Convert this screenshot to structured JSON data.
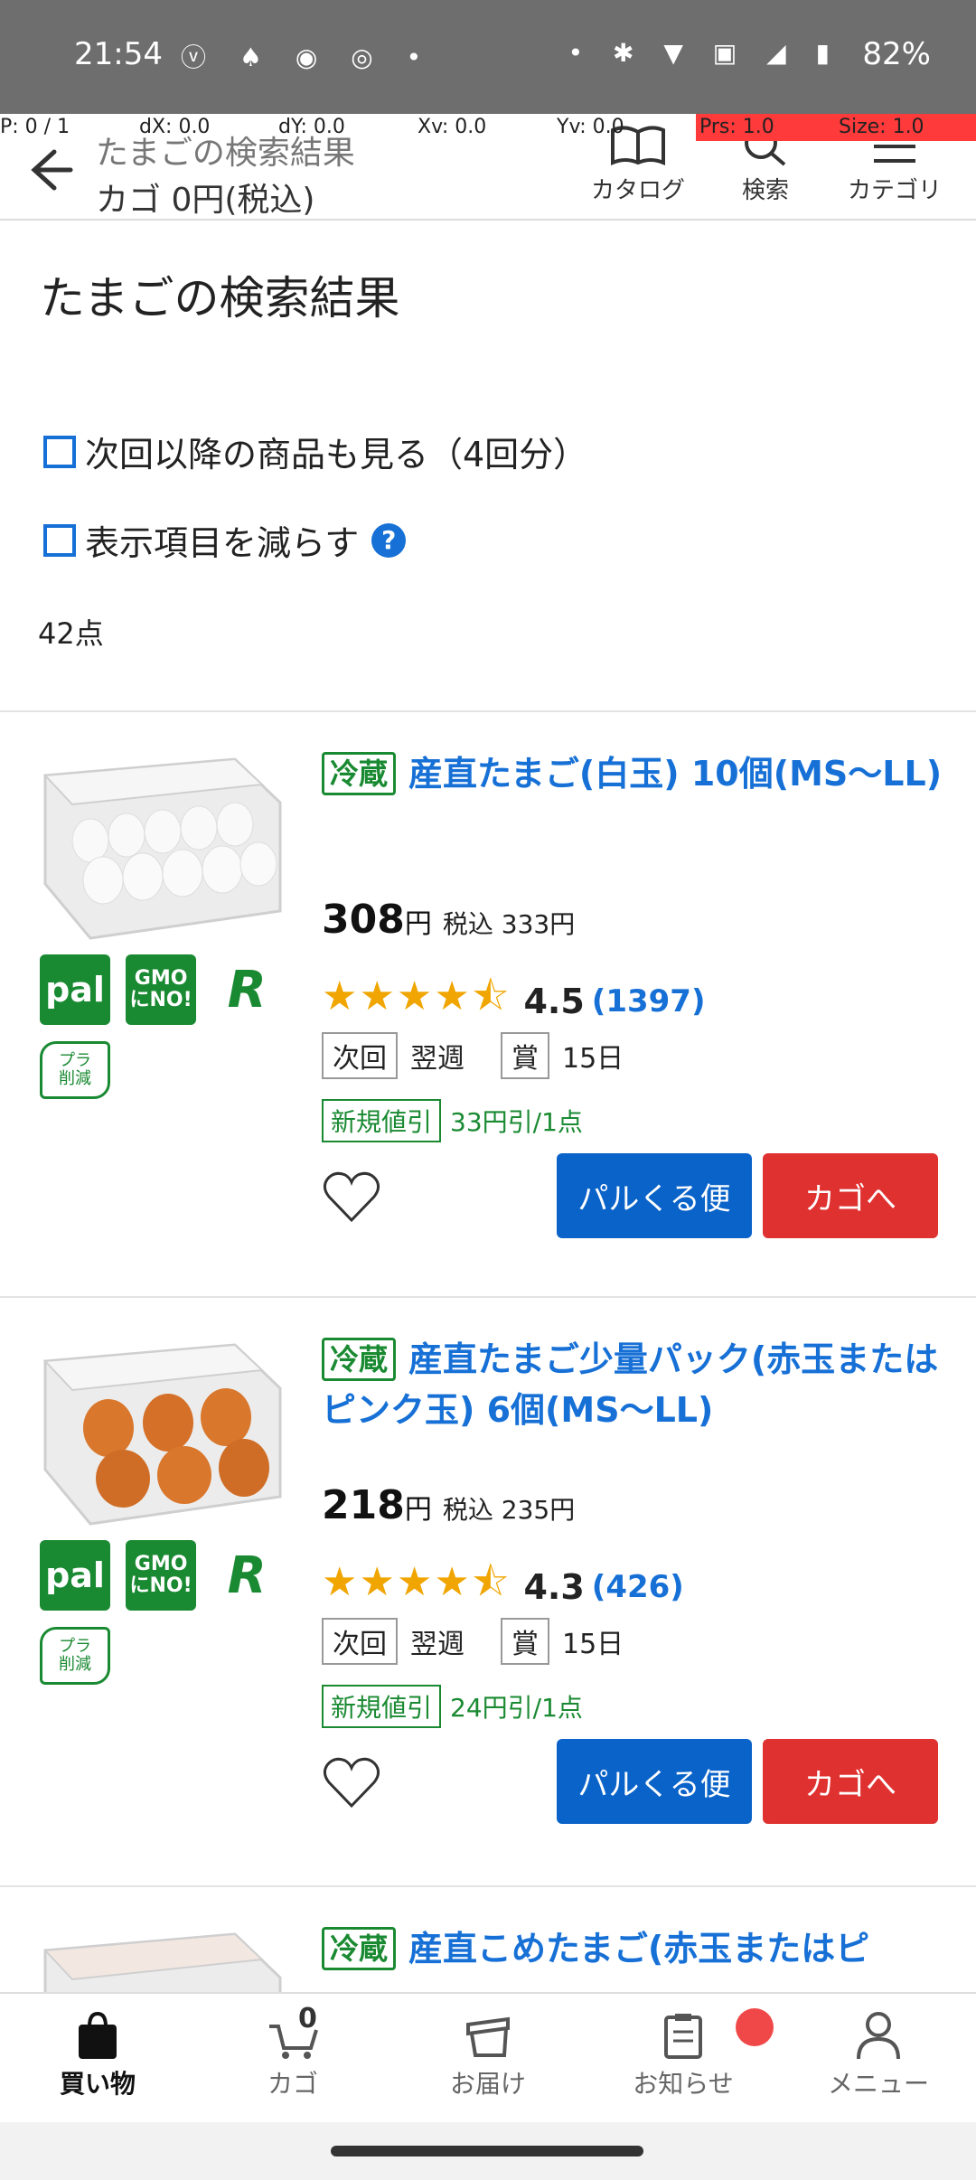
{
  "status_bar": {
    "time": "21:54",
    "battery": "82%",
    "left_icons": [
      "ⓥ",
      "♦",
      "LINE",
      "◎",
      "•"
    ],
    "right_icons": [
      "•",
      "✱",
      "▼",
      "VoLTE",
      "◢",
      "▮"
    ]
  },
  "debug_overlay": {
    "p": "P: 0 / 1",
    "dx": "dX: 0.0",
    "dy": "dY: 0.0",
    "xv": "Xv: 0.0",
    "yv": "Yv: 0.0",
    "prs": "Prs: 1.0",
    "size": "Size: 1.0"
  },
  "header": {
    "title": "たまごの検索結果",
    "cart": "カゴ 0円(税込)",
    "catalog": "カタログ",
    "search": "検索",
    "category": "カテゴリ"
  },
  "page": {
    "title": "たまごの検索結果",
    "option_next": "次回以降の商品も見る（4回分）",
    "option_reduce": "表示項目を減らす",
    "help": "?",
    "count": "42点"
  },
  "products": [
    {
      "tag": "冷蔵",
      "name": "産直たまご(白玉) 10個(MS～LL)",
      "price": "308",
      "yen": "円",
      "tax_price": "税込 333円",
      "stars": "★★★★⯪",
      "rating": "4.5",
      "reviews": "(1397)",
      "next_label": "次回",
      "next_value": "翌週",
      "award_label": "賞",
      "award_value": "15日",
      "discount_tag": "新規値引",
      "discount_text": "33円引/1点",
      "palkuru": "パルくる便",
      "add_cart": "カゴへ",
      "egg_color": "#f4f4f4",
      "badges": {
        "pal": "pal",
        "gmo1": "GMO",
        "gmo2": "にNO!",
        "r": "R",
        "pla1": "プラ",
        "pla2": "削減"
      }
    },
    {
      "tag": "冷蔵",
      "name": "産直たまご少量パック(赤玉またはピンク玉) 6個(MS～LL)",
      "price": "218",
      "yen": "円",
      "tax_price": "税込 235円",
      "stars": "★★★★⯪",
      "rating": "4.3",
      "reviews": "(426)",
      "next_label": "次回",
      "next_value": "翌週",
      "award_label": "賞",
      "award_value": "15日",
      "discount_tag": "新規値引",
      "discount_text": "24円引/1点",
      "palkuru": "パルくる便",
      "add_cart": "カゴへ",
      "egg_color": "#d9772c",
      "badges": {
        "pal": "pal",
        "gmo1": "GMO",
        "gmo2": "にNO!",
        "r": "R",
        "pla1": "プラ",
        "pla2": "削減"
      }
    },
    {
      "tag": "冷蔵",
      "name": "産直こめたまご(赤玉またはピ"
    }
  ],
  "bottom_nav": {
    "shopping": "買い物",
    "cart": "カゴ",
    "cart_count": "0",
    "delivery": "お届け",
    "notice": "お知らせ",
    "menu": "メニュー"
  },
  "colors": {
    "brand_blue": "#1670d6",
    "cart_red": "#e03131",
    "green": "#1a8a32",
    "star": "#f0a500"
  }
}
